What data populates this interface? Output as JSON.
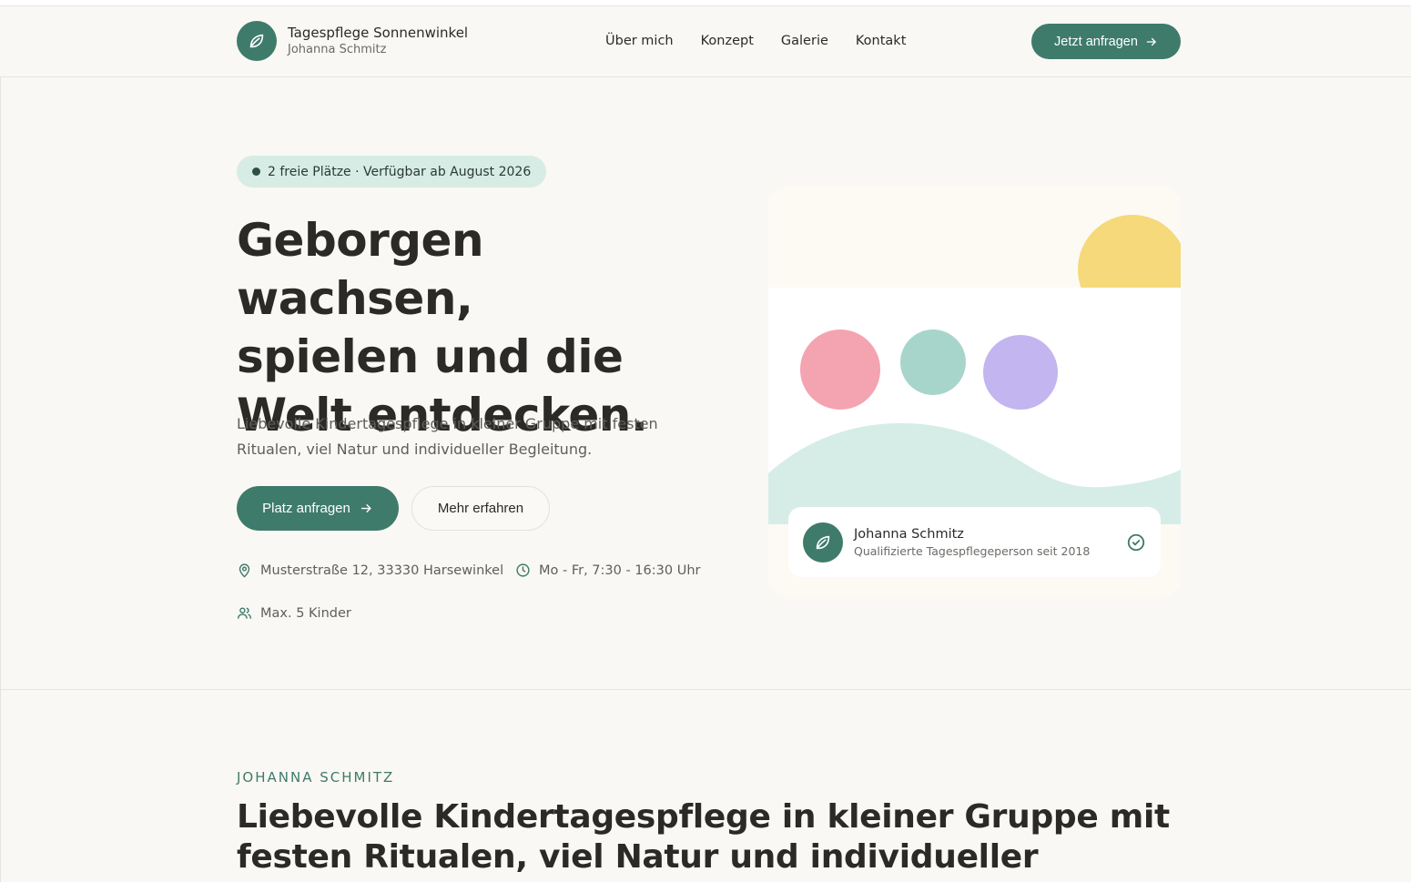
{
  "header": {
    "brand_title": "Tagespflege Sonnenwinkel",
    "brand_subtitle": "Johanna Schmitz",
    "nav": [
      {
        "label": "Über mich"
      },
      {
        "label": "Konzept"
      },
      {
        "label": "Galerie"
      },
      {
        "label": "Kontakt"
      }
    ],
    "cta_label": "Jetzt anfragen",
    "logo_icon": "leaf-icon"
  },
  "hero": {
    "badge": "2 freie Plätze · Verfügbar ab August 2026",
    "headline_lines": [
      "Geborgen wachsen,",
      "spielen und die",
      "Welt entdecken."
    ],
    "lead": "Liebevolle Kindertagespflege in kleiner Gruppe mit festen Ritualen, viel Natur und individueller Begleitung.",
    "primary_button": "Platz anfragen",
    "secondary_button": "Mehr erfahren",
    "info": {
      "address": "Musterstraße 12, 33330 Harsewinkel",
      "hours": "Mo - Fr, 7:30 - 16:30 Uhr",
      "capacity": "Max. 5 Kinder"
    }
  },
  "card": {
    "name": "Johanna Schmitz",
    "subtitle": "Qualifizierte Tagespflegeperson seit 2018"
  },
  "about": {
    "eyebrow": "JOHANNA SCHMITZ",
    "headline": "Liebevolle Kindertagespflege in kleiner Gruppe mit festen Ritualen, viel Natur und individueller Begleitung."
  },
  "colors": {
    "accent": "#3f7b6a",
    "badge_bg": "#d7ece5",
    "sun": "#f5d97a",
    "pink": "#f4a3b1",
    "mint": "#a8d5cb",
    "lavender": "#c3b5ef",
    "wave": "#d6ede7"
  }
}
